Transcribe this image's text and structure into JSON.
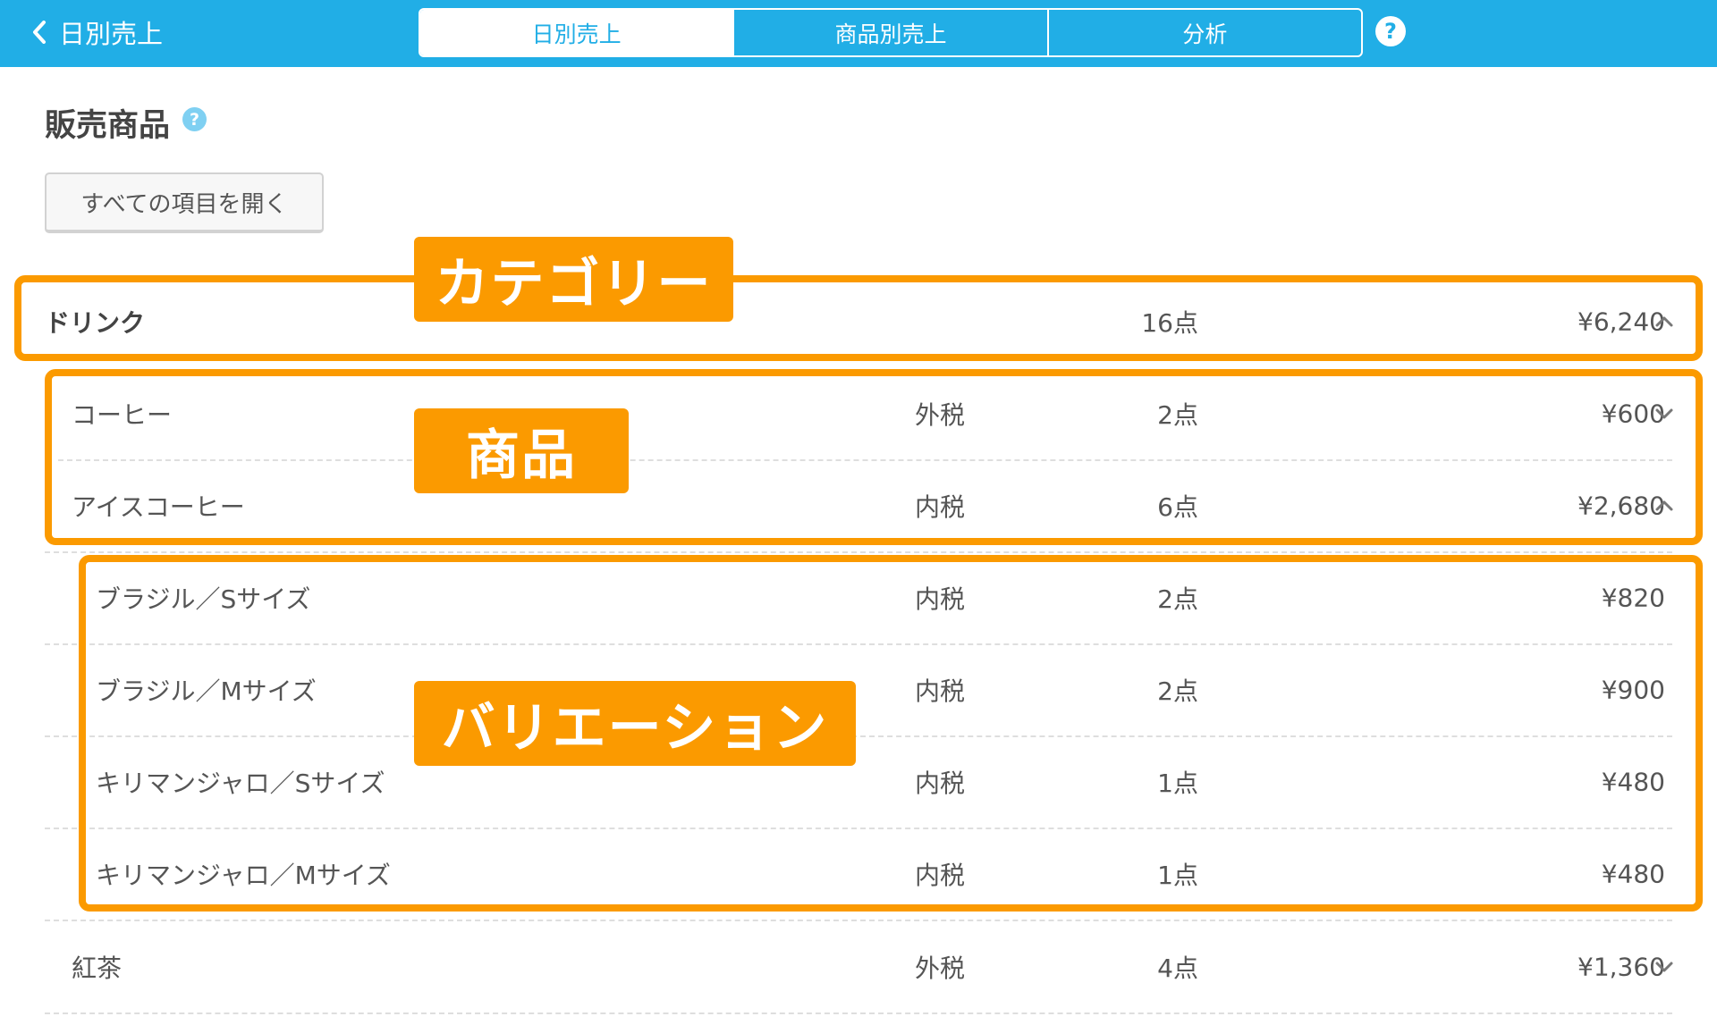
{
  "header": {
    "back_label": "日別売上",
    "tabs": [
      {
        "label": "日別売上",
        "active": true
      },
      {
        "label": "商品別売上",
        "active": false
      },
      {
        "label": "分析",
        "active": false
      }
    ],
    "help_icon": "?"
  },
  "section": {
    "title": "販売商品",
    "help_icon": "?",
    "expand_button": "すべての項目を開く"
  },
  "category": {
    "name": "ドリンク",
    "qty": "16点",
    "price": "¥6,240",
    "expanded": true
  },
  "products": [
    {
      "name": "コーヒー",
      "tax": "外税",
      "qty": "2点",
      "price": "¥600",
      "expanded": false
    },
    {
      "name": "アイスコーヒー",
      "tax": "内税",
      "qty": "6点",
      "price": "¥2,680",
      "expanded": true
    }
  ],
  "variations": [
    {
      "name": "ブラジル／Sサイズ",
      "tax": "内税",
      "qty": "2点",
      "price": "¥820"
    },
    {
      "name": "ブラジル／Mサイズ",
      "tax": "内税",
      "qty": "2点",
      "price": "¥900"
    },
    {
      "name": "キリマンジャロ／Sサイズ",
      "tax": "内税",
      "qty": "1点",
      "price": "¥480"
    },
    {
      "name": "キリマンジャロ／Mサイズ",
      "tax": "内税",
      "qty": "1点",
      "price": "¥480"
    }
  ],
  "product_after": {
    "name": "紅茶",
    "tax": "外税",
    "qty": "4点",
    "price": "¥1,360",
    "expanded": false
  },
  "annotations": {
    "category_label": "カテゴリー",
    "product_label": "商品",
    "variation_label": "バリエーション"
  },
  "colors": {
    "header": "#21aee6",
    "highlight": "#fb9a00"
  }
}
